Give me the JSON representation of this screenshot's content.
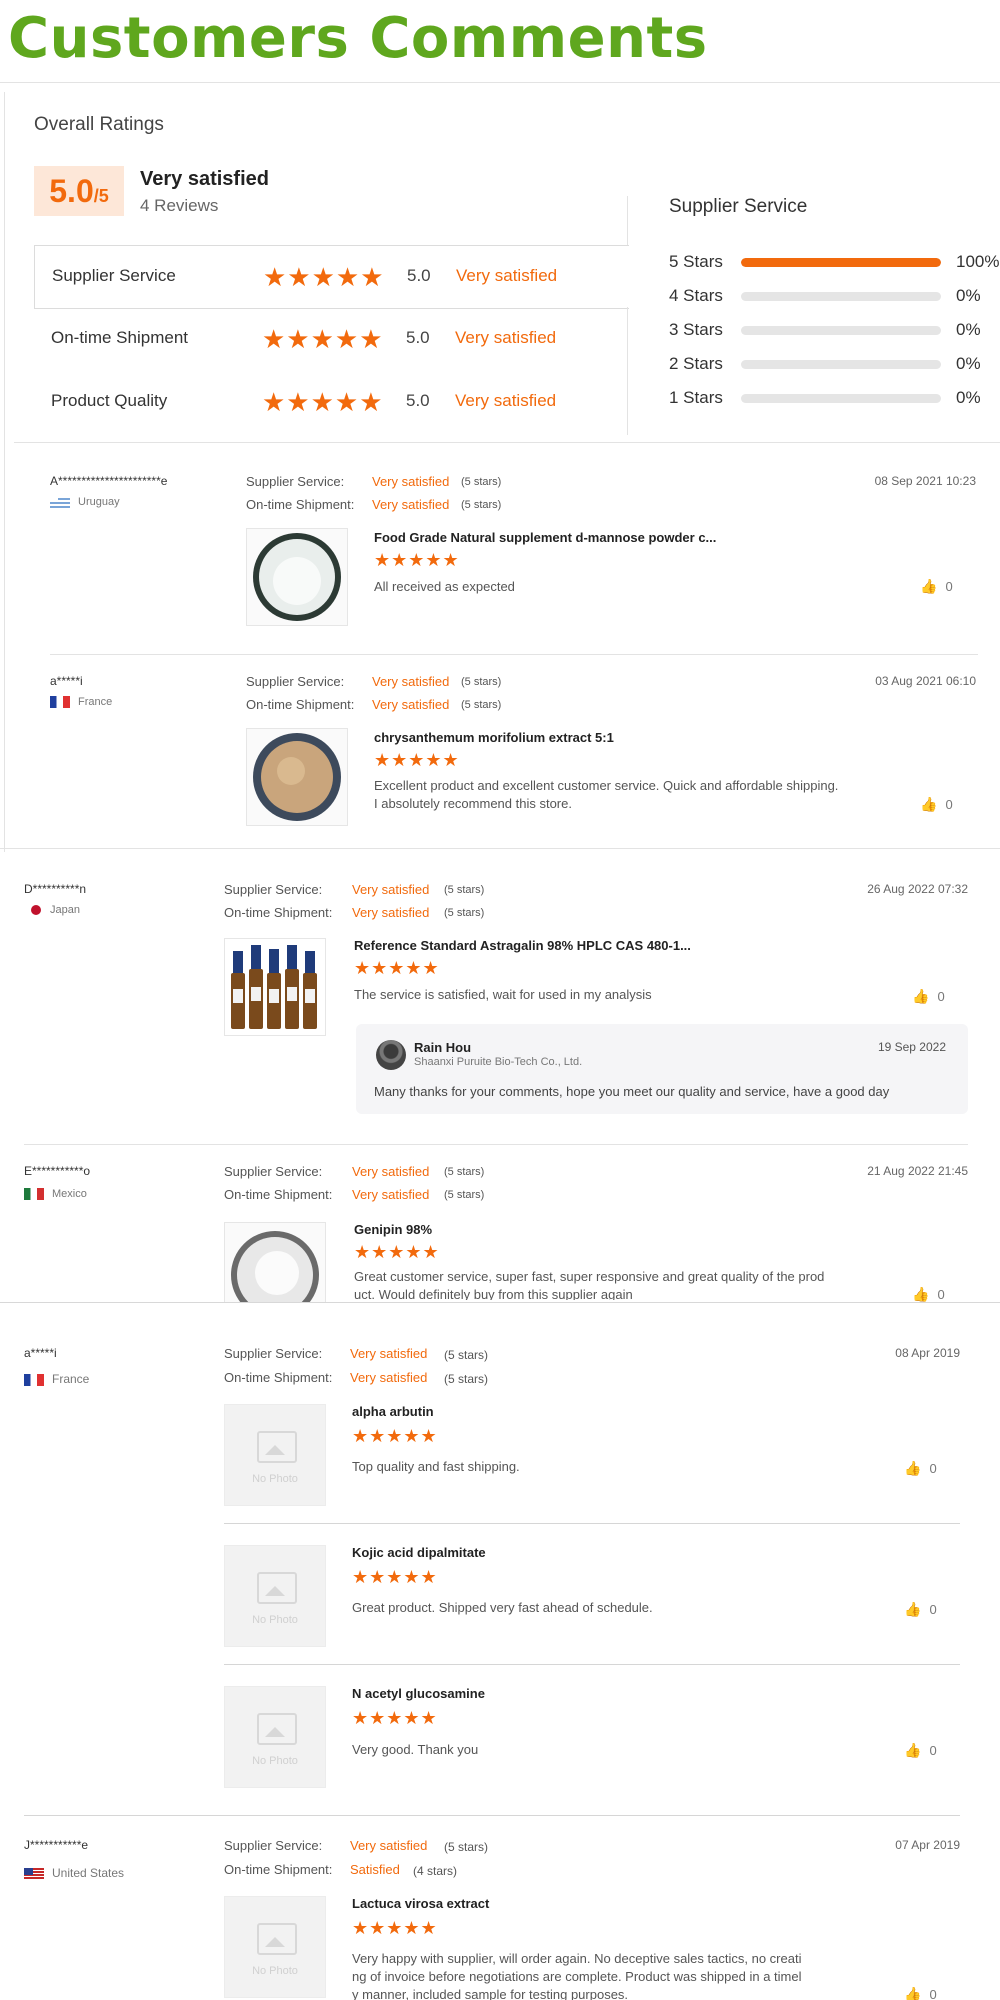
{
  "page_title": "Customers Comments",
  "overall": {
    "label": "Overall Ratings",
    "score_big": "5.0",
    "score_small": "/5",
    "summary": "Very satisfied",
    "reviews_count": "4 Reviews"
  },
  "ratings": [
    {
      "label": "Supplier Service",
      "stars": "★★★★★",
      "value": "5.0",
      "desc": "Very satisfied"
    },
    {
      "label": "On-time Shipment",
      "stars": "★★★★★",
      "value": "5.0",
      "desc": "Very satisfied"
    },
    {
      "label": "Product Quality",
      "stars": "★★★★★",
      "value": "5.0",
      "desc": "Very satisfied"
    }
  ],
  "supplier_service": {
    "title": "Supplier Service",
    "bars": [
      {
        "label": "5 Stars",
        "pct": "100%",
        "fraction": 1.0
      },
      {
        "label": "4 Stars",
        "pct": "0%",
        "fraction": 0
      },
      {
        "label": "3 Stars",
        "pct": "0%",
        "fraction": 0
      },
      {
        "label": "2 Stars",
        "pct": "0%",
        "fraction": 0
      },
      {
        "label": "1 Stars",
        "pct": "0%",
        "fraction": 0
      }
    ]
  },
  "labels": {
    "supplier_service": "Supplier Service:",
    "ontime_shipment": "On-time Shipment:",
    "no_photo": "No Photo"
  },
  "reviews": [
    {
      "user": "A**********************e",
      "country": "Uruguay",
      "date": "08 Sep 2021 10:23",
      "ss_val": "Very satisfied",
      "ss_stars": "(5 stars)",
      "os_val": "Very satisfied",
      "os_stars": "(5 stars)",
      "product": "Food Grade Natural supplement d-mannose powder c...",
      "rating": "★★★★★",
      "comment": "All received as expected",
      "likes": "0"
    },
    {
      "user": "a*****i",
      "country": "France",
      "date": "03 Aug 2021 06:10",
      "ss_val": "Very satisfied",
      "ss_stars": "(5 stars)",
      "os_val": "Very satisfied",
      "os_stars": "(5 stars)",
      "product": "chrysanthemum morifolium extract 5:1",
      "rating": "★★★★★",
      "comment_1": "Excellent product and excellent customer service. Quick and affordable shipping.",
      "comment_2": "I absolutely recommend this store.",
      "likes": "0"
    },
    {
      "user": "D**********n",
      "country": "Japan",
      "date": "26 Aug 2022 07:32",
      "ss_val": "Very satisfied",
      "ss_stars": "(5 stars)",
      "os_val": "Very satisfied",
      "os_stars": "(5 stars)",
      "product": "Reference Standard Astragalin 98% HPLC CAS 480-1...",
      "rating": "★★★★★",
      "comment": "The service is satisfied, wait for used in my analysis",
      "likes": "0",
      "reply": {
        "name": "Rain Hou",
        "company": "Shaanxi Puruite Bio-Tech Co., Ltd.",
        "date": "19 Sep 2022",
        "text": "Many thanks for your comments, hope you meet our quality and service, have a good day"
      }
    },
    {
      "user": "E***********o",
      "country": "Mexico",
      "date": "21 Aug 2022 21:45",
      "ss_val": "Very satisfied",
      "ss_stars": "(5 stars)",
      "os_val": "Very satisfied",
      "os_stars": "(5 stars)",
      "product": "Genipin 98%",
      "rating": "★★★★★",
      "comment_1": "Great customer service, super fast, super responsive and great quality of the prod",
      "comment_2": "uct. Would definitely buy from this supplier again",
      "likes": "0"
    },
    {
      "user": "a*****i",
      "country": "France",
      "date": "08 Apr 2019",
      "ss_val": "Very satisfied",
      "ss_stars": "(5 stars)",
      "os_val": "Very satisfied",
      "os_stars": "(5 stars)",
      "items": [
        {
          "product": "alpha arbutin",
          "rating": "★★★★★",
          "comment": "Top quality and fast shipping.",
          "likes": "0"
        },
        {
          "product": "Kojic acid dipalmitate",
          "rating": "★★★★★",
          "comment": "Great product. Shipped very fast ahead of schedule.",
          "likes": "0"
        },
        {
          "product": "N acetyl glucosamine",
          "rating": "★★★★★",
          "comment": "Very good. Thank you",
          "likes": "0"
        }
      ]
    },
    {
      "user": "J***********e",
      "country": "United States",
      "date": "07 Apr 2019",
      "ss_val": "Very satisfied",
      "ss_stars": "(5 stars)",
      "os_val": "Satisfied",
      "os_stars": "(4 stars)",
      "product": "Lactuca virosa extract",
      "rating": "★★★★★",
      "comment_1": "Very happy with supplier, will order again. No deceptive sales tactics, no creati",
      "comment_2": "ng of invoice before negotiations are complete. Product was shipped in a timel",
      "comment_3": "y manner, included sample for testing purposes.",
      "likes": "0"
    }
  ]
}
